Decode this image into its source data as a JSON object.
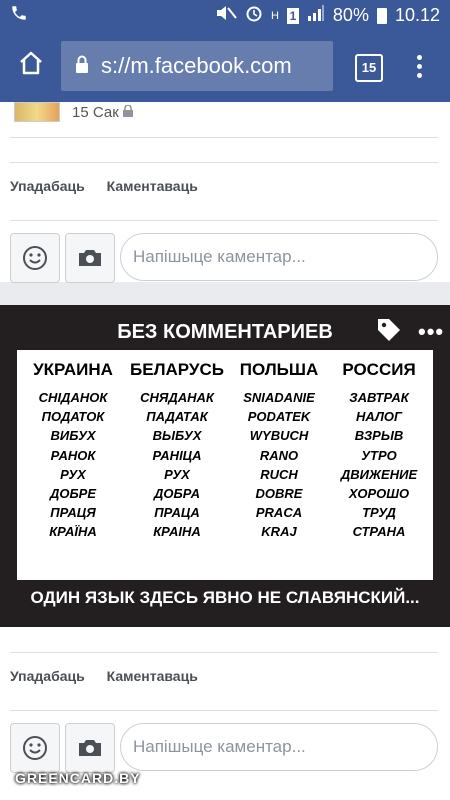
{
  "status_bar": {
    "battery": "80%",
    "time": "10.12",
    "sim": "1",
    "network": "H"
  },
  "browser": {
    "url": "s://m.facebook.com",
    "tab_count": "15"
  },
  "post_top": {
    "date": "15 Сак"
  },
  "actions": {
    "like": "Упадабаць",
    "comment": "Каментаваць"
  },
  "comment": {
    "placeholder": "Напішыце каментар..."
  },
  "image": {
    "title": "БЕЗ КОММЕНТАРИЕВ",
    "footer": "ОДИН ЯЗЫК ЗДЕСЬ ЯВНО НЕ СЛАВЯНСКИЙ...",
    "columns": [
      {
        "header": "УКРАИНА",
        "words": [
          "СНІДАНОК",
          "ПОДАТОК",
          "ВИБУХ",
          "РАНОК",
          "РУХ",
          "ДОБРЕ",
          "ПРАЦЯ",
          "КРАЇНА"
        ]
      },
      {
        "header": "БЕЛАРУСЬ",
        "words": [
          "СНЯДАНАК",
          "ПАДАТАК",
          "ВЫБУХ",
          "РАНІЦА",
          "РУХ",
          "ДОБРА",
          "ПРАЦА",
          "КРАІНА"
        ]
      },
      {
        "header": "ПОЛЬША",
        "words": [
          "SNIADANIE",
          "PODATEK",
          "WYBUCH",
          "RANO",
          "RUCH",
          "DOBRE",
          "PRACA",
          "KRAJ"
        ]
      },
      {
        "header": "РОССИЯ",
        "words": [
          "ЗАВТРАК",
          "НАЛОГ",
          "ВЗРЫВ",
          "УТРО",
          "ДВИЖЕНИЕ",
          "ХОРОШО",
          "ТРУД",
          "СТРАНА"
        ]
      }
    ]
  },
  "watermark": "GREENCARD.BY",
  "icons": [
    "phone-icon",
    "mute-icon",
    "alarm-icon",
    "signal-icon",
    "battery-icon",
    "home-icon",
    "lock-icon",
    "menu-icon",
    "emoji-icon",
    "camera-icon",
    "tag-icon",
    "more-icon"
  ]
}
